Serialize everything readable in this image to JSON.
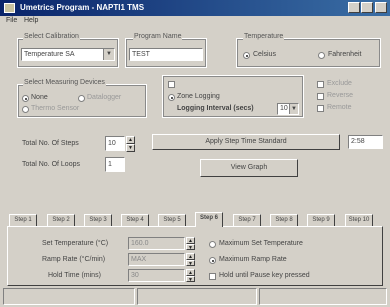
{
  "window": {
    "title": "Umetrics Program - NAPTI1 TMS"
  },
  "menu": [
    {
      "label": "File"
    },
    {
      "label": "Help"
    }
  ],
  "select_calibration": {
    "label": "Select Calibration",
    "value": "Temperature SA"
  },
  "program_name": {
    "label": "Program Name",
    "value": "TEST"
  },
  "temp_mode": {
    "label": "Temperature",
    "options": [
      {
        "label": "Celsius",
        "selected": true
      },
      {
        "label": "Fahrenheit",
        "selected": false
      }
    ]
  },
  "measuring_device": {
    "label": "Select Measuring Devices",
    "options": [
      {
        "label": "None",
        "selected": true
      },
      {
        "label": "Datalogger",
        "selected": false
      },
      {
        "label": "Thermo Sensor",
        "selected": false
      }
    ]
  },
  "logging": {
    "option1": "",
    "zone_logging_label": "Zone Logging",
    "interval_label": "Logging Interval (secs)",
    "interval_value": "10"
  },
  "right_options": [
    {
      "label": "Exclude",
      "checked": false
    },
    {
      "label": "Reverse",
      "checked": false
    },
    {
      "label": "Remote",
      "checked": false
    }
  ],
  "total_steps": {
    "label": "Total No. Of Steps",
    "value": "10"
  },
  "total_loops": {
    "label": "Total No. Of Loops",
    "value": "1"
  },
  "apply_button": {
    "label": "Apply Step Time Standard"
  },
  "time_value": "2:58",
  "view_graph_button": {
    "label": "View Graph"
  },
  "tabs": [
    {
      "label": "Step 1"
    },
    {
      "label": "Step 2"
    },
    {
      "label": "Step 3"
    },
    {
      "label": "Step 4"
    },
    {
      "label": "Step 5"
    },
    {
      "label": "Step 6"
    },
    {
      "label": "Step 7"
    },
    {
      "label": "Step 8"
    },
    {
      "label": "Step 9"
    },
    {
      "label": "Step 10"
    }
  ],
  "active_tab": 5,
  "step": {
    "set_temp_label": "Set Temperature (°C)",
    "set_temp_value": "160.0",
    "ramp_rate_label": "Ramp Rate (°C/min)",
    "ramp_rate_value": "MAX",
    "hold_time_label": "Hold Time (mins)",
    "hold_time_value": "30",
    "max_set_temp_label": "Maximum Set Temperature",
    "max_ramp_rate_label": "Maximum Ramp Rate",
    "hold_until_label": "Hold until Pause key pressed"
  },
  "colors": {
    "titlebar": "#0a246a",
    "face": "#d4d0c8"
  }
}
